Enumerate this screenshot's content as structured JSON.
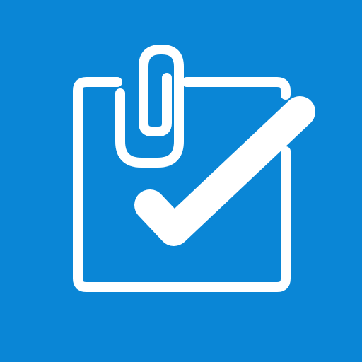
{
  "icon": {
    "name": "clipboard-check-paperclip-icon",
    "parts": [
      "note-square-icon",
      "paperclip-icon",
      "checkmark-icon"
    ]
  },
  "colors": {
    "background": "#0A86D6",
    "foreground": "#FFFFFF"
  }
}
